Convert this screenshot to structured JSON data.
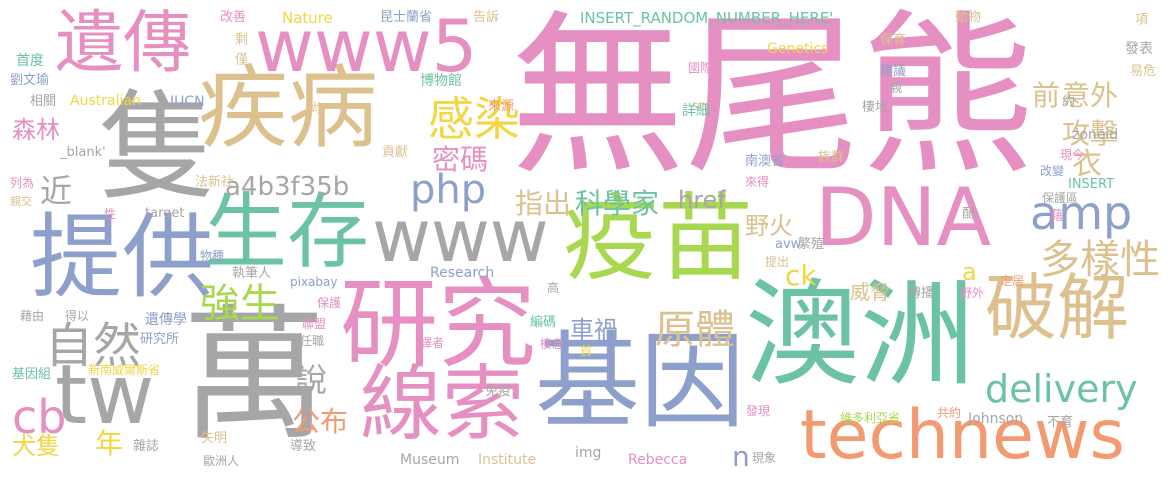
{
  "palette": {
    "pink": "#e58fc2",
    "gray": "#a6a6a6",
    "orange": "#f39a71",
    "tan": "#dcc18f",
    "teal": "#6cc3a4",
    "blue": "#8da0cb",
    "green": "#a8d850",
    "yellow": "#f2d643"
  },
  "words": [
    "無尾熊",
    "DNA",
    "澳洲",
    "疫苗",
    "萬",
    "基因",
    "technews",
    "研究",
    "提供",
    "隻",
    "疾病",
    "遺傳",
    "www5",
    "生存",
    "線索",
    "tw",
    "www",
    "破解",
    "delivery",
    "自然",
    "感染",
    "cb",
    "php",
    "amp",
    "多樣性",
    "原體",
    "強生",
    "說",
    "a4b3f35b",
    "科學家",
    "指出",
    "攻擊",
    "意外",
    "衣",
    "前",
    "森林",
    "密碼",
    "href",
    "公布",
    "近",
    "車禍",
    "野火",
    "ck",
    "威脅",
    "年",
    "犬隻",
    "n",
    "a",
    "INSERT_RANDOM_NUMBER_HERE'",
    "Genetics",
    "Nature",
    "Australian",
    "IUCN",
    "Research",
    "Institute",
    "Museum",
    "Rebecca",
    "Johnson",
    "target",
    "pixabay",
    "_blank'",
    "zoneid",
    "INSERT",
    "src",
    "img",
    "avw",
    "首度",
    "劉文瑜",
    "相關",
    "改善",
    "剩",
    "僅",
    "昆士蘭省",
    "告訴",
    "動物",
    "項",
    "保育",
    "易危",
    "建議",
    "約",
    "發表",
    "國際",
    "博物館",
    "來源",
    "尚",
    "貢獻",
    "族群",
    "現今",
    "改變",
    "南澳省",
    "來得",
    "棲地",
    "親",
    "詳細",
    "法新社",
    "保護區",
    "性",
    "列為",
    "親交",
    "藉",
    "藉由",
    "得以",
    "物種",
    "保護",
    "聯盟",
    "執筆人",
    "傳播",
    "遺傳學",
    "研究所",
    "任職",
    "高",
    "定居",
    "野外",
    "提出",
    "繁殖",
    "配",
    "基因組",
    "新南威爾斯省",
    "譯者",
    "棲息",
    "首",
    "編碼",
    "免疫",
    "發現",
    "維多利亞省",
    "共約",
    "不育",
    "雜誌",
    "導致",
    "失明",
    "歐洲人",
    "現象"
  ]
}
